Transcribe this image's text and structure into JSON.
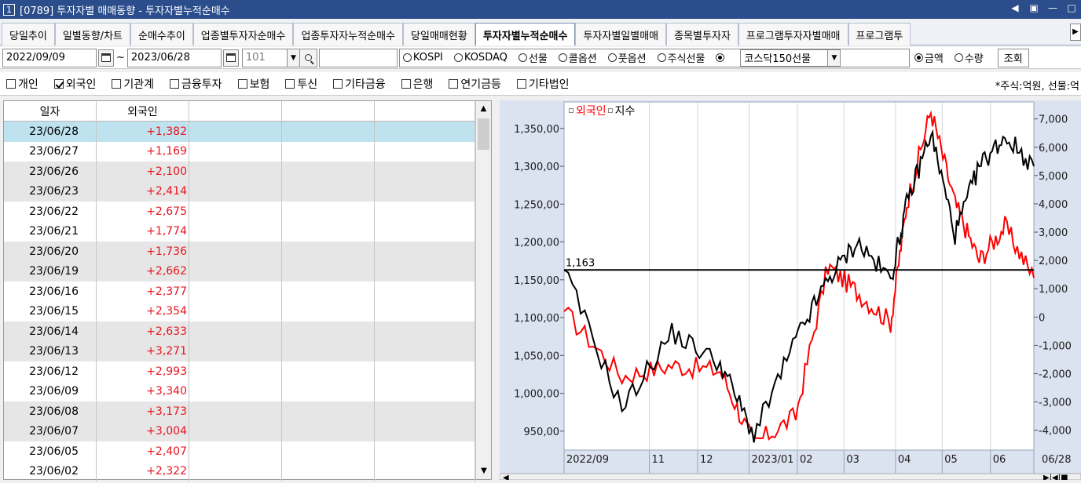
{
  "window": {
    "num": "1",
    "title": "[0789] 투자자별 매매동향 - 투자자별누적순매수",
    "controls": [
      "◀",
      "▣",
      "—",
      "□"
    ]
  },
  "tabs": [
    {
      "label": "당일추이"
    },
    {
      "label": "일별동향/차트"
    },
    {
      "label": "순매수추이"
    },
    {
      "label": "업종별투자자순매수"
    },
    {
      "label": "업종투자자누적순매수"
    },
    {
      "label": "당일매매현황"
    },
    {
      "label": "투자자별누적순매수",
      "active": true
    },
    {
      "label": "투자자별일별매매"
    },
    {
      "label": "종목별투자자"
    },
    {
      "label": "프로그램투자자별매매"
    },
    {
      "label": "프로그램투"
    }
  ],
  "filters": {
    "start_date": "2022/09/09",
    "tilde": "~",
    "end_date": "2023/06/28",
    "code": "101",
    "search_value": "",
    "market_options": [
      {
        "label": "KOSPI",
        "selected": false
      },
      {
        "label": "KOSDAQ",
        "selected": false
      },
      {
        "label": "선물",
        "selected": false
      },
      {
        "label": "콜옵션",
        "selected": false
      },
      {
        "label": "풋옵션",
        "selected": false
      },
      {
        "label": "주식선물",
        "selected": false
      },
      {
        "label": "",
        "selected": true
      }
    ],
    "futures_select": "코스닥150선물",
    "mode_options": [
      {
        "label": "금액",
        "selected": true
      },
      {
        "label": "수량",
        "selected": false
      }
    ],
    "query_button": "조회"
  },
  "investors": [
    {
      "label": "개인",
      "checked": false
    },
    {
      "label": "외국인",
      "checked": true
    },
    {
      "label": "기관계",
      "checked": false
    },
    {
      "label": "금융투자",
      "checked": false
    },
    {
      "label": "보험",
      "checked": false
    },
    {
      "label": "투신",
      "checked": false
    },
    {
      "label": "기타금융",
      "checked": false
    },
    {
      "label": "은행",
      "checked": false
    },
    {
      "label": "연기금등",
      "checked": false
    },
    {
      "label": "기타법인",
      "checked": false
    }
  ],
  "unit_note": "*주식:억원, 선물:억",
  "table": {
    "headers": [
      "일자",
      "외국인",
      "",
      "",
      ""
    ],
    "rows": [
      {
        "date": "23/06/28",
        "value": "+1,382"
      },
      {
        "date": "23/06/27",
        "value": "+1,169"
      },
      {
        "date": "23/06/26",
        "value": "+2,100"
      },
      {
        "date": "23/06/23",
        "value": "+2,414"
      },
      {
        "date": "23/06/22",
        "value": "+2,675"
      },
      {
        "date": "23/06/21",
        "value": "+1,774"
      },
      {
        "date": "23/06/20",
        "value": "+1,736"
      },
      {
        "date": "23/06/19",
        "value": "+2,662"
      },
      {
        "date": "23/06/16",
        "value": "+2,377"
      },
      {
        "date": "23/06/15",
        "value": "+2,354"
      },
      {
        "date": "23/06/14",
        "value": "+2,633"
      },
      {
        "date": "23/06/13",
        "value": "+3,271"
      },
      {
        "date": "23/06/12",
        "value": "+2,993"
      },
      {
        "date": "23/06/09",
        "value": "+3,340"
      },
      {
        "date": "23/06/08",
        "value": "+3,173"
      },
      {
        "date": "23/06/07",
        "value": "+3,004"
      },
      {
        "date": "23/06/05",
        "value": "+2,407"
      },
      {
        "date": "23/06/02",
        "value": "+2,322"
      }
    ]
  },
  "chart": {
    "legend": [
      {
        "label": "외국인",
        "color": "#ff0000"
      },
      {
        "label": "지수",
        "color": "#000000"
      }
    ],
    "left_ticks": [
      "1,350,00",
      "1,300,00",
      "1,250,00",
      "1,200,00",
      "1,150,00",
      "1,100,00",
      "1,050,00",
      "1,000,00",
      "950,00"
    ],
    "right_ticks": [
      "7,000",
      "6,000",
      "5,000",
      "4,000",
      "3,000",
      "2,000",
      "1,000",
      "0",
      "-1,000",
      "-2,000",
      "-3,000",
      "-4,000"
    ],
    "x_ticks": [
      "2022/09",
      "11",
      "12",
      "2023/01",
      "02",
      "03",
      "04",
      "05",
      "06",
      "06/28"
    ],
    "reference_label": "1,163",
    "colors": {
      "foreign": "#ff0000",
      "index": "#000000",
      "plot_bg": "#ffffff",
      "axis_bg": "#dbe3f1"
    }
  },
  "chart_data": {
    "type": "line",
    "x": [
      "2022/09/09",
      "2022/10/15",
      "2022/11/15",
      "2022/12/15",
      "2023/01/05",
      "2023/01/31",
      "2023/02/20",
      "2023/03/10",
      "2023/03/31",
      "2023/04/10",
      "2023/04/25",
      "2023/05/10",
      "2023/05/25",
      "2023/06/10",
      "2023/06/28"
    ],
    "series": [
      {
        "name": "지수",
        "axis": "left",
        "values": [
          1163,
          980,
          1080,
          1040,
          945,
          1070,
          1150,
          1200,
          1150,
          1250,
          1345,
          1210,
          1300,
          1340,
          1300
        ]
      },
      {
        "name": "외국인",
        "axis": "right",
        "values": [
          200,
          -2100,
          -1700,
          -1900,
          -4500,
          -3500,
          1800,
          900,
          -200,
          4000,
          7300,
          4000,
          2000,
          3200,
          1382
        ]
      }
    ],
    "left_ylim": [
      925,
      1385
    ],
    "right_ylim": [
      -4700,
      7600
    ],
    "reference_line": 1163,
    "grid": true
  }
}
